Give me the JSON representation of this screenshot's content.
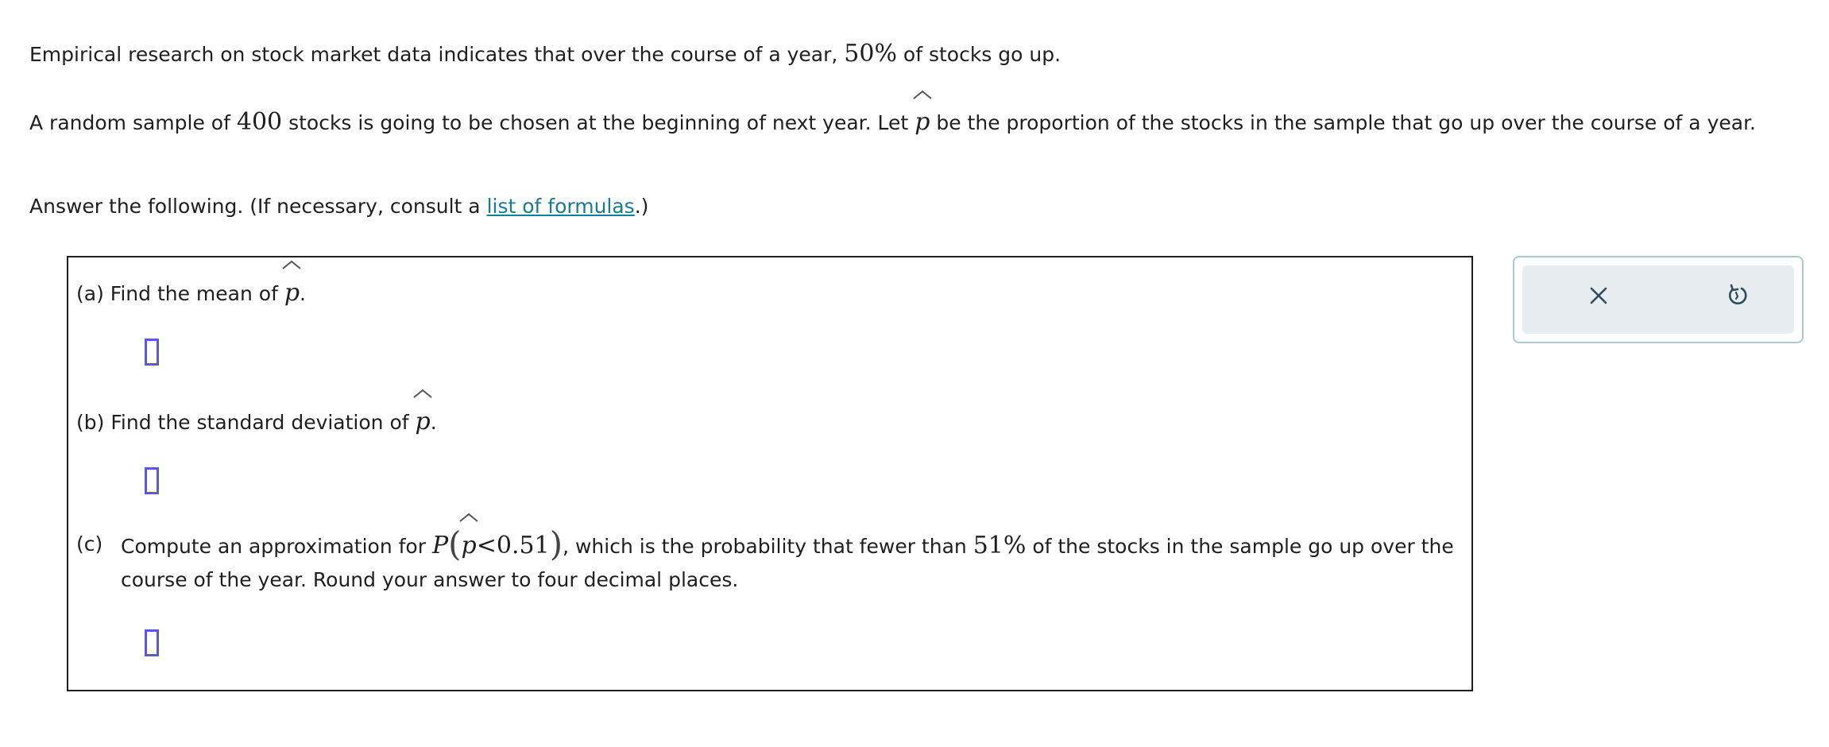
{
  "intro": {
    "line1_before": "Empirical research on stock market data indicates that over the course of a year,",
    "line1_pct": "50%",
    "line1_after": "of stocks go up.",
    "line2_before": "A random sample of",
    "line2_n": "400",
    "line2_mid": "stocks is going to be chosen at the beginning of next year. Let",
    "line2_var": "p",
    "line2_after": "be the proportion of the stocks in the sample that go up over the course of a year.",
    "line3_before": "Answer the following. (If necessary, consult a",
    "line3_link": "list of formulas",
    "line3_after": ".)"
  },
  "questions": {
    "a": {
      "label": "(a)",
      "text": "Find the mean of",
      "var": "p",
      "end": "."
    },
    "b": {
      "label": "(b)",
      "text": "Find the standard deviation of",
      "var": "p",
      "end": "."
    },
    "c": {
      "label": "(c)",
      "text_before": "Compute an approximation for",
      "P": "P",
      "var": "p",
      "lt": "<",
      "value": "0.51",
      "text_mid": ", which is the probability that fewer than",
      "pct": "51%",
      "text_after": "of the stocks in the sample go up over the course of the year. Round your answer to four decimal places."
    }
  },
  "tools": {
    "clear_icon": "x-icon",
    "reset_icon": "undo-icon"
  },
  "colors": {
    "link": "#137e96",
    "answer_box_border": "#5b57e0",
    "tool_panel_bg": "#e7edf0",
    "tool_icon": "#2f4b5c"
  }
}
